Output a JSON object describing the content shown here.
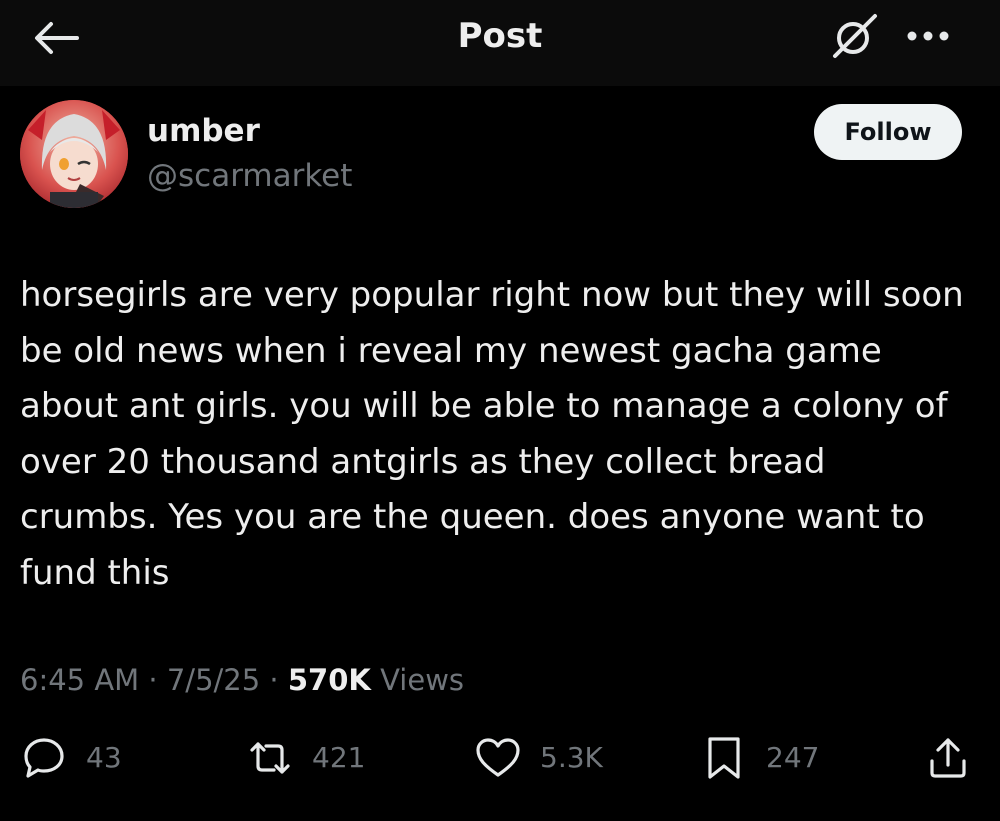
{
  "header": {
    "title": "Post",
    "back_icon": "arrow-left-icon",
    "grok_icon": "grok-icon",
    "more_icon": "more-dots-icon"
  },
  "author": {
    "name": "umber",
    "handle": "@scarmarket",
    "follow_label": "Follow",
    "avatar_icon": "avatar"
  },
  "post": {
    "text": "horsegirls are very popular right now but they will soon be old news when i reveal my newest gacha game about ant girls. you will be able to manage a colony of over 20 thousand antgirls as they collect bread crumbs. Yes you are the queen. does anyone want to fund this"
  },
  "meta": {
    "time": "6:45 AM",
    "sep1": " · ",
    "date": "7/5/25",
    "sep2": " · ",
    "views_count": "570K",
    "views_label": " Views"
  },
  "actions": {
    "replies": "43",
    "reposts": "421",
    "likes": "5.3K",
    "bookmarks": "247"
  },
  "colors": {
    "background": "#000000",
    "header_bg": "#0b0b0b",
    "text": "#eeeeee",
    "muted": "#71767b",
    "follow_bg": "#eff3f4",
    "follow_text": "#0f1419"
  }
}
